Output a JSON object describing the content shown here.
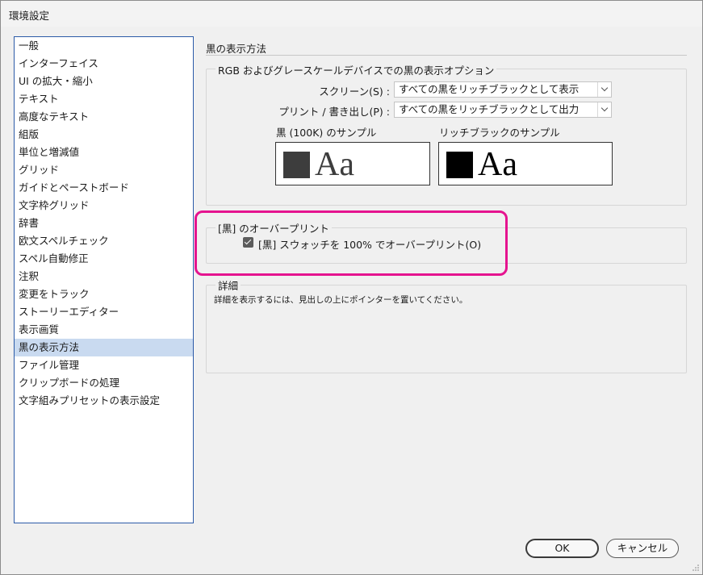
{
  "window": {
    "title": "環境設定"
  },
  "sidebar": {
    "items": [
      {
        "label": "一般"
      },
      {
        "label": "インターフェイス"
      },
      {
        "label": "UI の拡大・縮小"
      },
      {
        "label": "テキスト"
      },
      {
        "label": "高度なテキスト"
      },
      {
        "label": "組版"
      },
      {
        "label": "単位と増減値"
      },
      {
        "label": "グリッド"
      },
      {
        "label": "ガイドとペーストボード"
      },
      {
        "label": "文字枠グリッド"
      },
      {
        "label": "辞書"
      },
      {
        "label": "欧文スペルチェック"
      },
      {
        "label": "スペル自動修正"
      },
      {
        "label": "注釈"
      },
      {
        "label": "変更をトラック"
      },
      {
        "label": "ストーリーエディター"
      },
      {
        "label": "表示画質"
      },
      {
        "label": "黒の表示方法"
      },
      {
        "label": "ファイル管理"
      },
      {
        "label": "クリップボードの処理"
      },
      {
        "label": "文字組みプリセットの表示設定"
      }
    ],
    "selected_index": 17
  },
  "panel": {
    "title": "黒の表示方法",
    "rgb_group": {
      "label": "RGB およびグレースケールデバイスでの黒の表示オプション",
      "screen_label": "スクリーン(S) :",
      "screen_value": "すべての黒をリッチブラックとして表示",
      "print_label": "プリント / 書き出し(P) :",
      "print_value": "すべての黒をリッチブラックとして出力",
      "sample_100k_label": "黒 (100K) のサンプル",
      "sample_rich_label": "リッチブラックのサンプル",
      "sample_text": "Aa",
      "swatch_100k_color": "#3d3d3d",
      "swatch_rich_color": "#000000"
    },
    "overprint_group": {
      "label": "[黒] のオーバープリント",
      "checkbox_label": "[黒] スウォッチを 100% でオーバープリント(O)",
      "checked": true
    },
    "detail_group": {
      "label": "詳細",
      "text": "詳細を表示するには、見出しの上にポインターを置いてください。"
    }
  },
  "buttons": {
    "ok_label": "OK",
    "cancel_label": "キャンセル"
  },
  "colors": {
    "highlight": "#e5138f",
    "selection": "#c9daf0"
  }
}
